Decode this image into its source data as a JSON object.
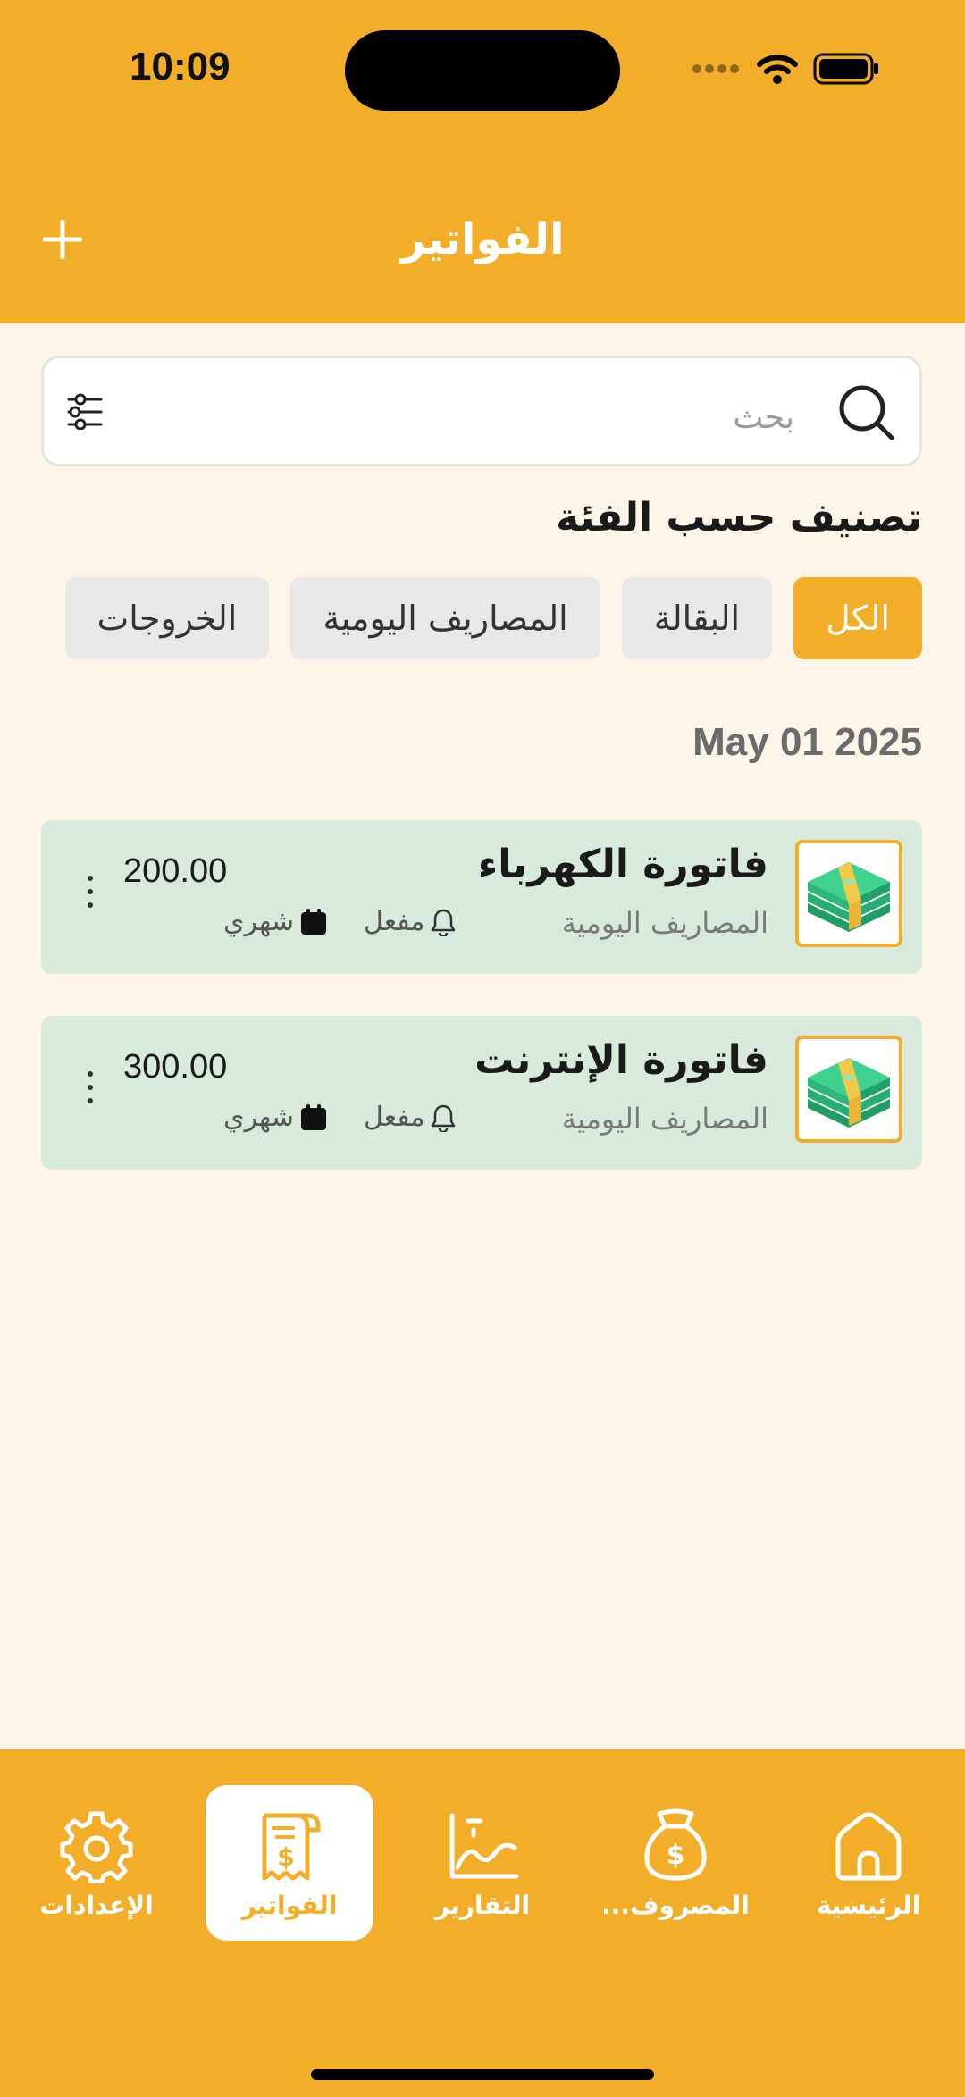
{
  "status_bar": {
    "time": "10:09"
  },
  "header": {
    "title": "الفواتير",
    "add_icon": "plus-icon"
  },
  "search": {
    "placeholder": "بحث",
    "value": ""
  },
  "categories": {
    "title": "تصنيف حسب الفئة",
    "chips": [
      {
        "label": "الكل",
        "active": true
      },
      {
        "label": "البقالة",
        "active": false
      },
      {
        "label": "المصاريف اليومية",
        "active": false
      },
      {
        "label": "الخروجات",
        "active": false
      }
    ]
  },
  "groups": [
    {
      "date": "May 01 2025",
      "bills": [
        {
          "name": "فاتورة الكهرباء",
          "category": "المصاريف اليومية",
          "amount": "200.00",
          "reminder": "مفعل",
          "frequency": "شهري",
          "icon": "money-stack-icon"
        },
        {
          "name": "فاتورة الإنترنت",
          "category": "المصاريف اليومية",
          "amount": "300.00",
          "reminder": "مفعل",
          "frequency": "شهري",
          "icon": "money-stack-icon"
        }
      ]
    }
  ],
  "tabbar": {
    "items": [
      {
        "label": "الرئيسية",
        "icon": "home-icon",
        "active": false
      },
      {
        "label": "المصروف...",
        "icon": "money-bag-icon",
        "active": false
      },
      {
        "label": "التقارير",
        "icon": "chart-icon",
        "active": false
      },
      {
        "label": "الفواتير",
        "icon": "receipt-icon",
        "active": true
      },
      {
        "label": "الإعدادات",
        "icon": "gear-icon",
        "active": false
      }
    ]
  },
  "colors": {
    "accent": "#f2ae28",
    "background": "#fdf5e8",
    "card": "#d8eadc",
    "chip": "#e8e8e8"
  }
}
